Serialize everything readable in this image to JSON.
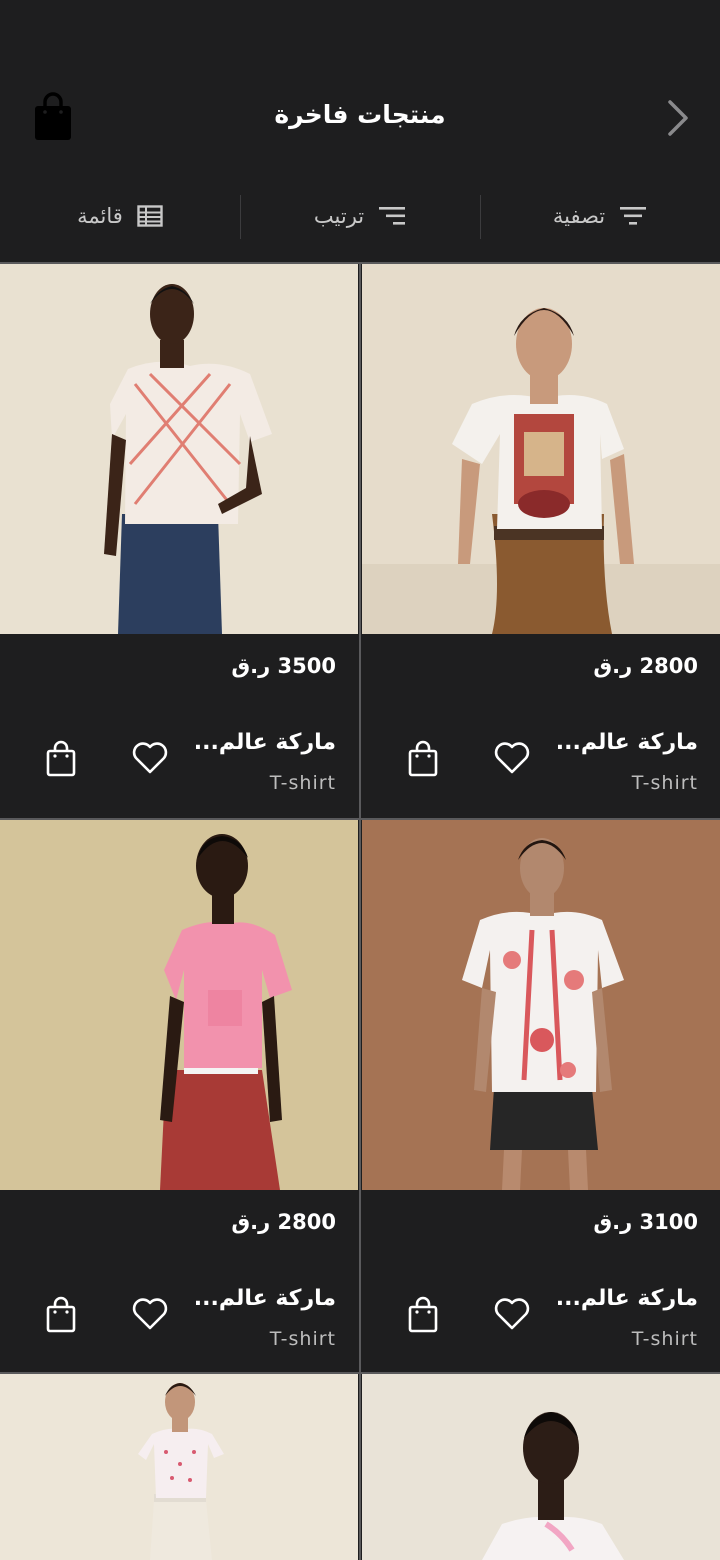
{
  "header": {
    "title": "منتجات فاخرة"
  },
  "toolbar": {
    "filter_label": "تصفية",
    "sort_label": "ترتيب",
    "list_label": "قائمة"
  },
  "products": [
    {
      "price": "2800 ر.ق",
      "brand": "ماركة عالم...",
      "name": "T-shirt"
    },
    {
      "price": "3500 ر.ق",
      "brand": "ماركة عالم...",
      "name": "T-shirt"
    },
    {
      "price": "3100 ر.ق",
      "brand": "ماركة عالم...",
      "name": "T-shirt"
    },
    {
      "price": "2800 ر.ق",
      "brand": "ماركة عالم...",
      "name": "T-shirt"
    }
  ],
  "colors": {
    "background": "#1e1e1f",
    "text": "#ffffff",
    "muted": "#bdbdbd",
    "divider": "#5a5a5c"
  },
  "icons": {
    "back": "chevron-right-icon",
    "bag": "shopping-bag-icon",
    "filter": "filter-icon",
    "sort": "sort-icon",
    "list": "list-view-icon",
    "favorite": "heart-icon",
    "cart": "add-to-bag-icon"
  }
}
